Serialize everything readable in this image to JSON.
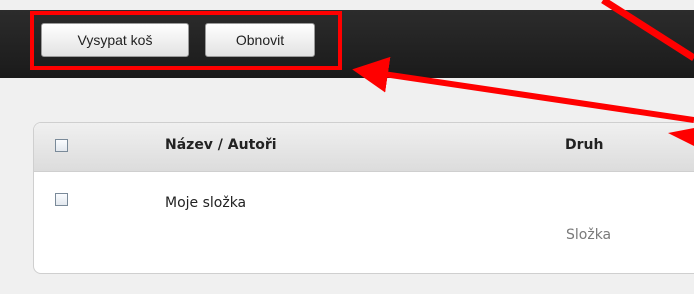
{
  "toolbar": {
    "empty_trash_label": "Vysypat koš",
    "refresh_label": "Obnovit"
  },
  "table": {
    "headers": {
      "name": "Název / Autoři",
      "type": "Druh"
    },
    "rows": [
      {
        "name": "Moje složka",
        "type": "Složka"
      }
    ]
  },
  "colors": {
    "annotation": "#ff0000",
    "toolbar_bg": "#1f1f1f"
  }
}
